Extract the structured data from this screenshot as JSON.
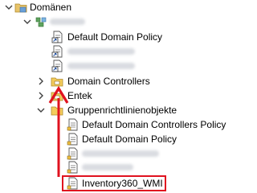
{
  "tree": {
    "domains_label": "Domänen",
    "default_domain_policy_label": "Default Domain Policy",
    "domain_controllers_label": "Domain Controllers",
    "entek_label": "Entek",
    "gpo_folder_label": "Gruppenrichtlinienobjekte",
    "gpo_default_domain_controllers_policy": "Default Domain Controllers Policy",
    "gpo_default_domain_policy": "Default Domain Policy",
    "gpo_inventory360_wmi": "Inventory360_WMI"
  },
  "annotation": {
    "color": "#e0121f"
  }
}
